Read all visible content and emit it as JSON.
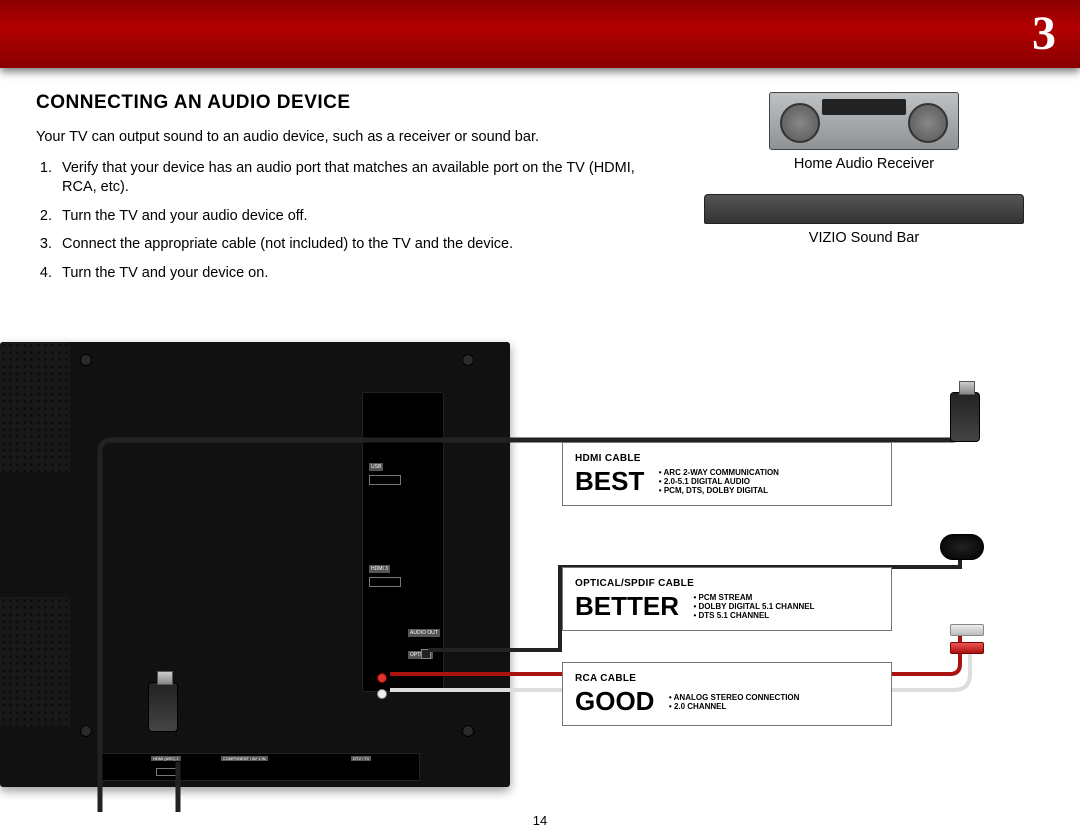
{
  "header": {
    "chapter_number": "3"
  },
  "section": {
    "title": "CONNECTING AN AUDIO DEVICE",
    "intro": "Your TV can output sound to an audio device, such as a receiver or sound bar.",
    "steps": [
      "Verify that your device has an audio port that matches an available port on the TV (HDMI, RCA, etc).",
      "Turn the TV and your audio device off.",
      "Connect the appropriate cable (not included) to the TV and the device.",
      "Turn the TV and your device on."
    ]
  },
  "devices": {
    "receiver_label": "Home Audio Receiver",
    "soundbar_label": "VIZIO Sound Bar"
  },
  "cables": {
    "best": {
      "name": "HDMI CABLE",
      "rating": "BEST",
      "features": [
        "ARC 2-WAY COMMUNICATION",
        "2.0-5.1 DIGITAL AUDIO",
        "PCM, DTS, DOLBY DIGITAL"
      ]
    },
    "better": {
      "name": "OPTICAL/SPDIF CABLE",
      "rating": "BETTER",
      "features": [
        "PCM STREAM",
        "DOLBY DIGITAL 5.1 CHANNEL",
        "DTS 5.1 CHANNEL"
      ]
    },
    "good": {
      "name": "RCA CABLE",
      "rating": "GOOD",
      "features": [
        "ANALOG STEREO CONNECTION",
        "2.0 CHANNEL"
      ]
    }
  },
  "ports": {
    "usb": "USB",
    "hdmi3": "HDMI 3",
    "audio_out": "AUDIO OUT",
    "optical": "OPTICAL",
    "hdmi_arc": "HDMI (ARC) 1",
    "component": "COMPONENT / AV 1 IN",
    "dtv": "DTV / TV"
  },
  "page_number": "14"
}
